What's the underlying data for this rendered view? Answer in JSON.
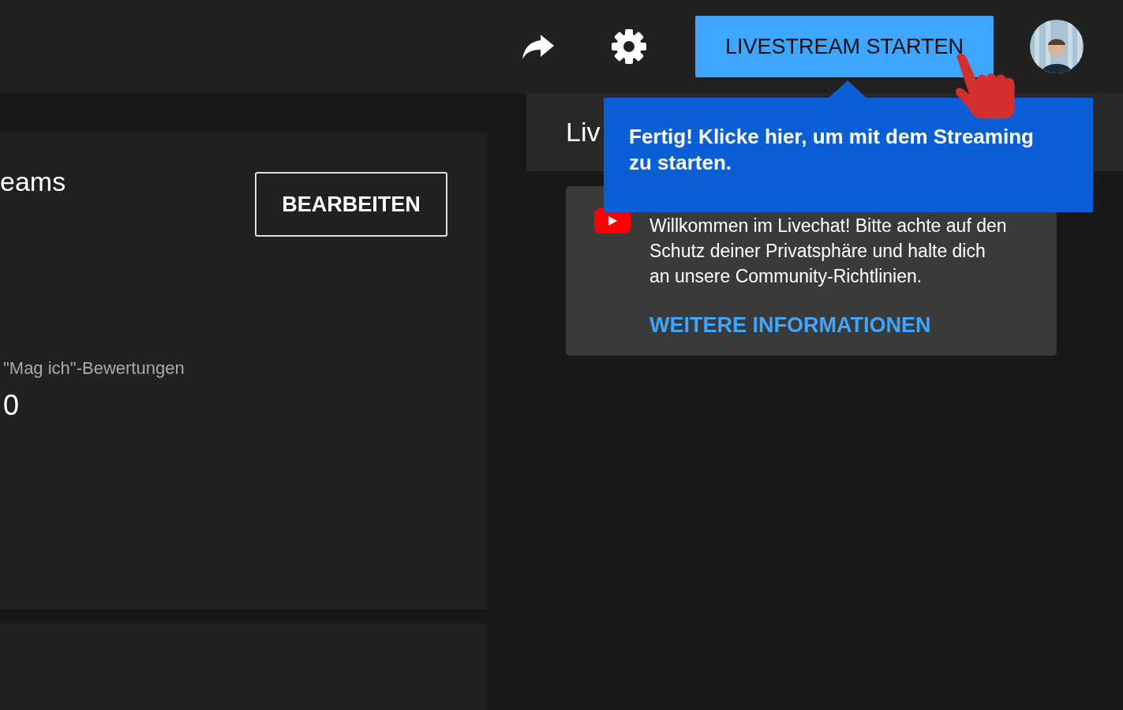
{
  "top_bar": {
    "start_button": "LIVESTREAM STARTEN"
  },
  "stream_panel": {
    "title": "eams",
    "edit_button": "BEARBEITEN",
    "stats": [
      {
        "label": "\"Mag ich\"-Bewertungen",
        "value": "0"
      }
    ]
  },
  "chat": {
    "title": "Liv",
    "message": "Willkommen im Livechat! Bitte achte auf den Schutz deiner Privatsphäre und halte dich an unsere Community-Richtlinien.",
    "link": "WEITERE INFORMATIONEN"
  },
  "tooltip": {
    "text": "Fertig! Klicke hier, um mit dem Streaming zu starten."
  }
}
